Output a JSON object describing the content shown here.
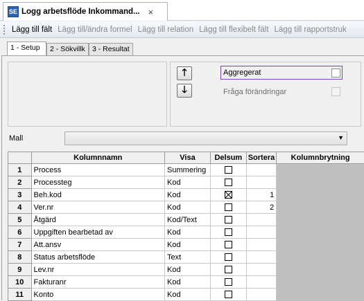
{
  "window": {
    "icon_text": "SE",
    "tab_title": "Logg arbetsflöde Inkommand...",
    "close_glyph": "×"
  },
  "toolbar": {
    "items": [
      {
        "label": "Lägg till fält",
        "enabled": true
      },
      {
        "label": "Lägg till/ändra formel",
        "enabled": false
      },
      {
        "label": "Lägg till relation",
        "enabled": false
      },
      {
        "label": "Lägg till flexibelt fält",
        "enabled": false
      },
      {
        "label": "Lägg till rapportstruk",
        "enabled": false
      }
    ]
  },
  "tabs": [
    {
      "label": "1 - Setup",
      "selected": true
    },
    {
      "label": "2 - Sökvillk",
      "selected": false
    },
    {
      "label": "3 - Resultat",
      "selected": false
    }
  ],
  "buttons": {
    "move_up": "🡑",
    "move_down": "🡓"
  },
  "options": {
    "aggregerat": {
      "label": "Aggregerat",
      "checked": false,
      "enabled": true
    },
    "fraga_forandringar": {
      "label": "Fråga förändringar",
      "checked": false,
      "enabled": false
    }
  },
  "mall": {
    "label": "Mall",
    "value": ""
  },
  "grid": {
    "columns": [
      "Kolumnnamn",
      "Visa",
      "Delsum",
      "Sortera",
      "Kolumnbrytning"
    ],
    "rows": [
      {
        "num": "1",
        "name": "Process",
        "visa": "Summering",
        "delsum": false,
        "sort": ""
      },
      {
        "num": "2",
        "name": "Processteg",
        "visa": "Kod",
        "delsum": false,
        "sort": ""
      },
      {
        "num": "3",
        "name": "Beh.kod",
        "visa": "Kod",
        "delsum": true,
        "sort": "1"
      },
      {
        "num": "4",
        "name": "Ver.nr",
        "visa": "Kod",
        "delsum": false,
        "sort": "2"
      },
      {
        "num": "5",
        "name": "Åtgärd",
        "visa": "Kod/Text",
        "delsum": false,
        "sort": ""
      },
      {
        "num": "6",
        "name": "Uppgiften bearbetad av",
        "visa": "Kod",
        "delsum": false,
        "sort": ""
      },
      {
        "num": "7",
        "name": "Att.ansv",
        "visa": "Kod",
        "delsum": false,
        "sort": ""
      },
      {
        "num": "8",
        "name": "Status arbetsflöde",
        "visa": "Text",
        "delsum": false,
        "sort": ""
      },
      {
        "num": "9",
        "name": "Lev.nr",
        "visa": "Kod",
        "delsum": false,
        "sort": ""
      },
      {
        "num": "10",
        "name": "Fakturanr",
        "visa": "Kod",
        "delsum": false,
        "sort": ""
      },
      {
        "num": "11",
        "name": "Konto",
        "visa": "Kod",
        "delsum": false,
        "sort": ""
      }
    ]
  }
}
